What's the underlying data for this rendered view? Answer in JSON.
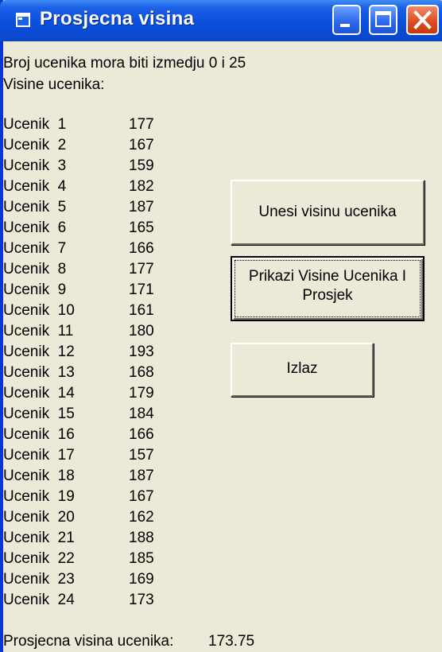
{
  "window": {
    "title": "Prosjecna visina",
    "controls": {
      "minimize": "minimize-icon",
      "maximize": "maximize-icon",
      "close": "close-icon"
    }
  },
  "info": {
    "range_message": "Broj ucenika mora biti izmedju 0 i 25",
    "heights_heading": "Visine ucenika:"
  },
  "students": [
    {
      "label": "Ucenik  1",
      "height": "177"
    },
    {
      "label": "Ucenik  2",
      "height": "167"
    },
    {
      "label": "Ucenik  3",
      "height": "159"
    },
    {
      "label": "Ucenik  4",
      "height": "182"
    },
    {
      "label": "Ucenik  5",
      "height": "187"
    },
    {
      "label": "Ucenik  6",
      "height": "165"
    },
    {
      "label": "Ucenik  7",
      "height": "166"
    },
    {
      "label": "Ucenik  8",
      "height": "177"
    },
    {
      "label": "Ucenik  9",
      "height": "171"
    },
    {
      "label": "Ucenik  10",
      "height": "161"
    },
    {
      "label": "Ucenik  11",
      "height": "180"
    },
    {
      "label": "Ucenik  12",
      "height": "193"
    },
    {
      "label": "Ucenik  13",
      "height": "168"
    },
    {
      "label": "Ucenik  14",
      "height": "179"
    },
    {
      "label": "Ucenik  15",
      "height": "184"
    },
    {
      "label": "Ucenik  16",
      "height": "166"
    },
    {
      "label": "Ucenik  17",
      "height": "157"
    },
    {
      "label": "Ucenik  18",
      "height": "187"
    },
    {
      "label": "Ucenik  19",
      "height": "167"
    },
    {
      "label": "Ucenik  20",
      "height": "162"
    },
    {
      "label": "Ucenik  21",
      "height": "188"
    },
    {
      "label": "Ucenik  22",
      "height": "185"
    },
    {
      "label": "Ucenik  23",
      "height": "169"
    },
    {
      "label": "Ucenik  24",
      "height": "173"
    }
  ],
  "average": {
    "label": "Prosjecna visina ucenika:",
    "value": "173.75"
  },
  "buttons": {
    "enter_height": "Unesi visinu ucenika",
    "show_line1": "Prikazi Visine Ucenika I",
    "show_line2": "Prosjek",
    "exit": "Izlaz"
  }
}
